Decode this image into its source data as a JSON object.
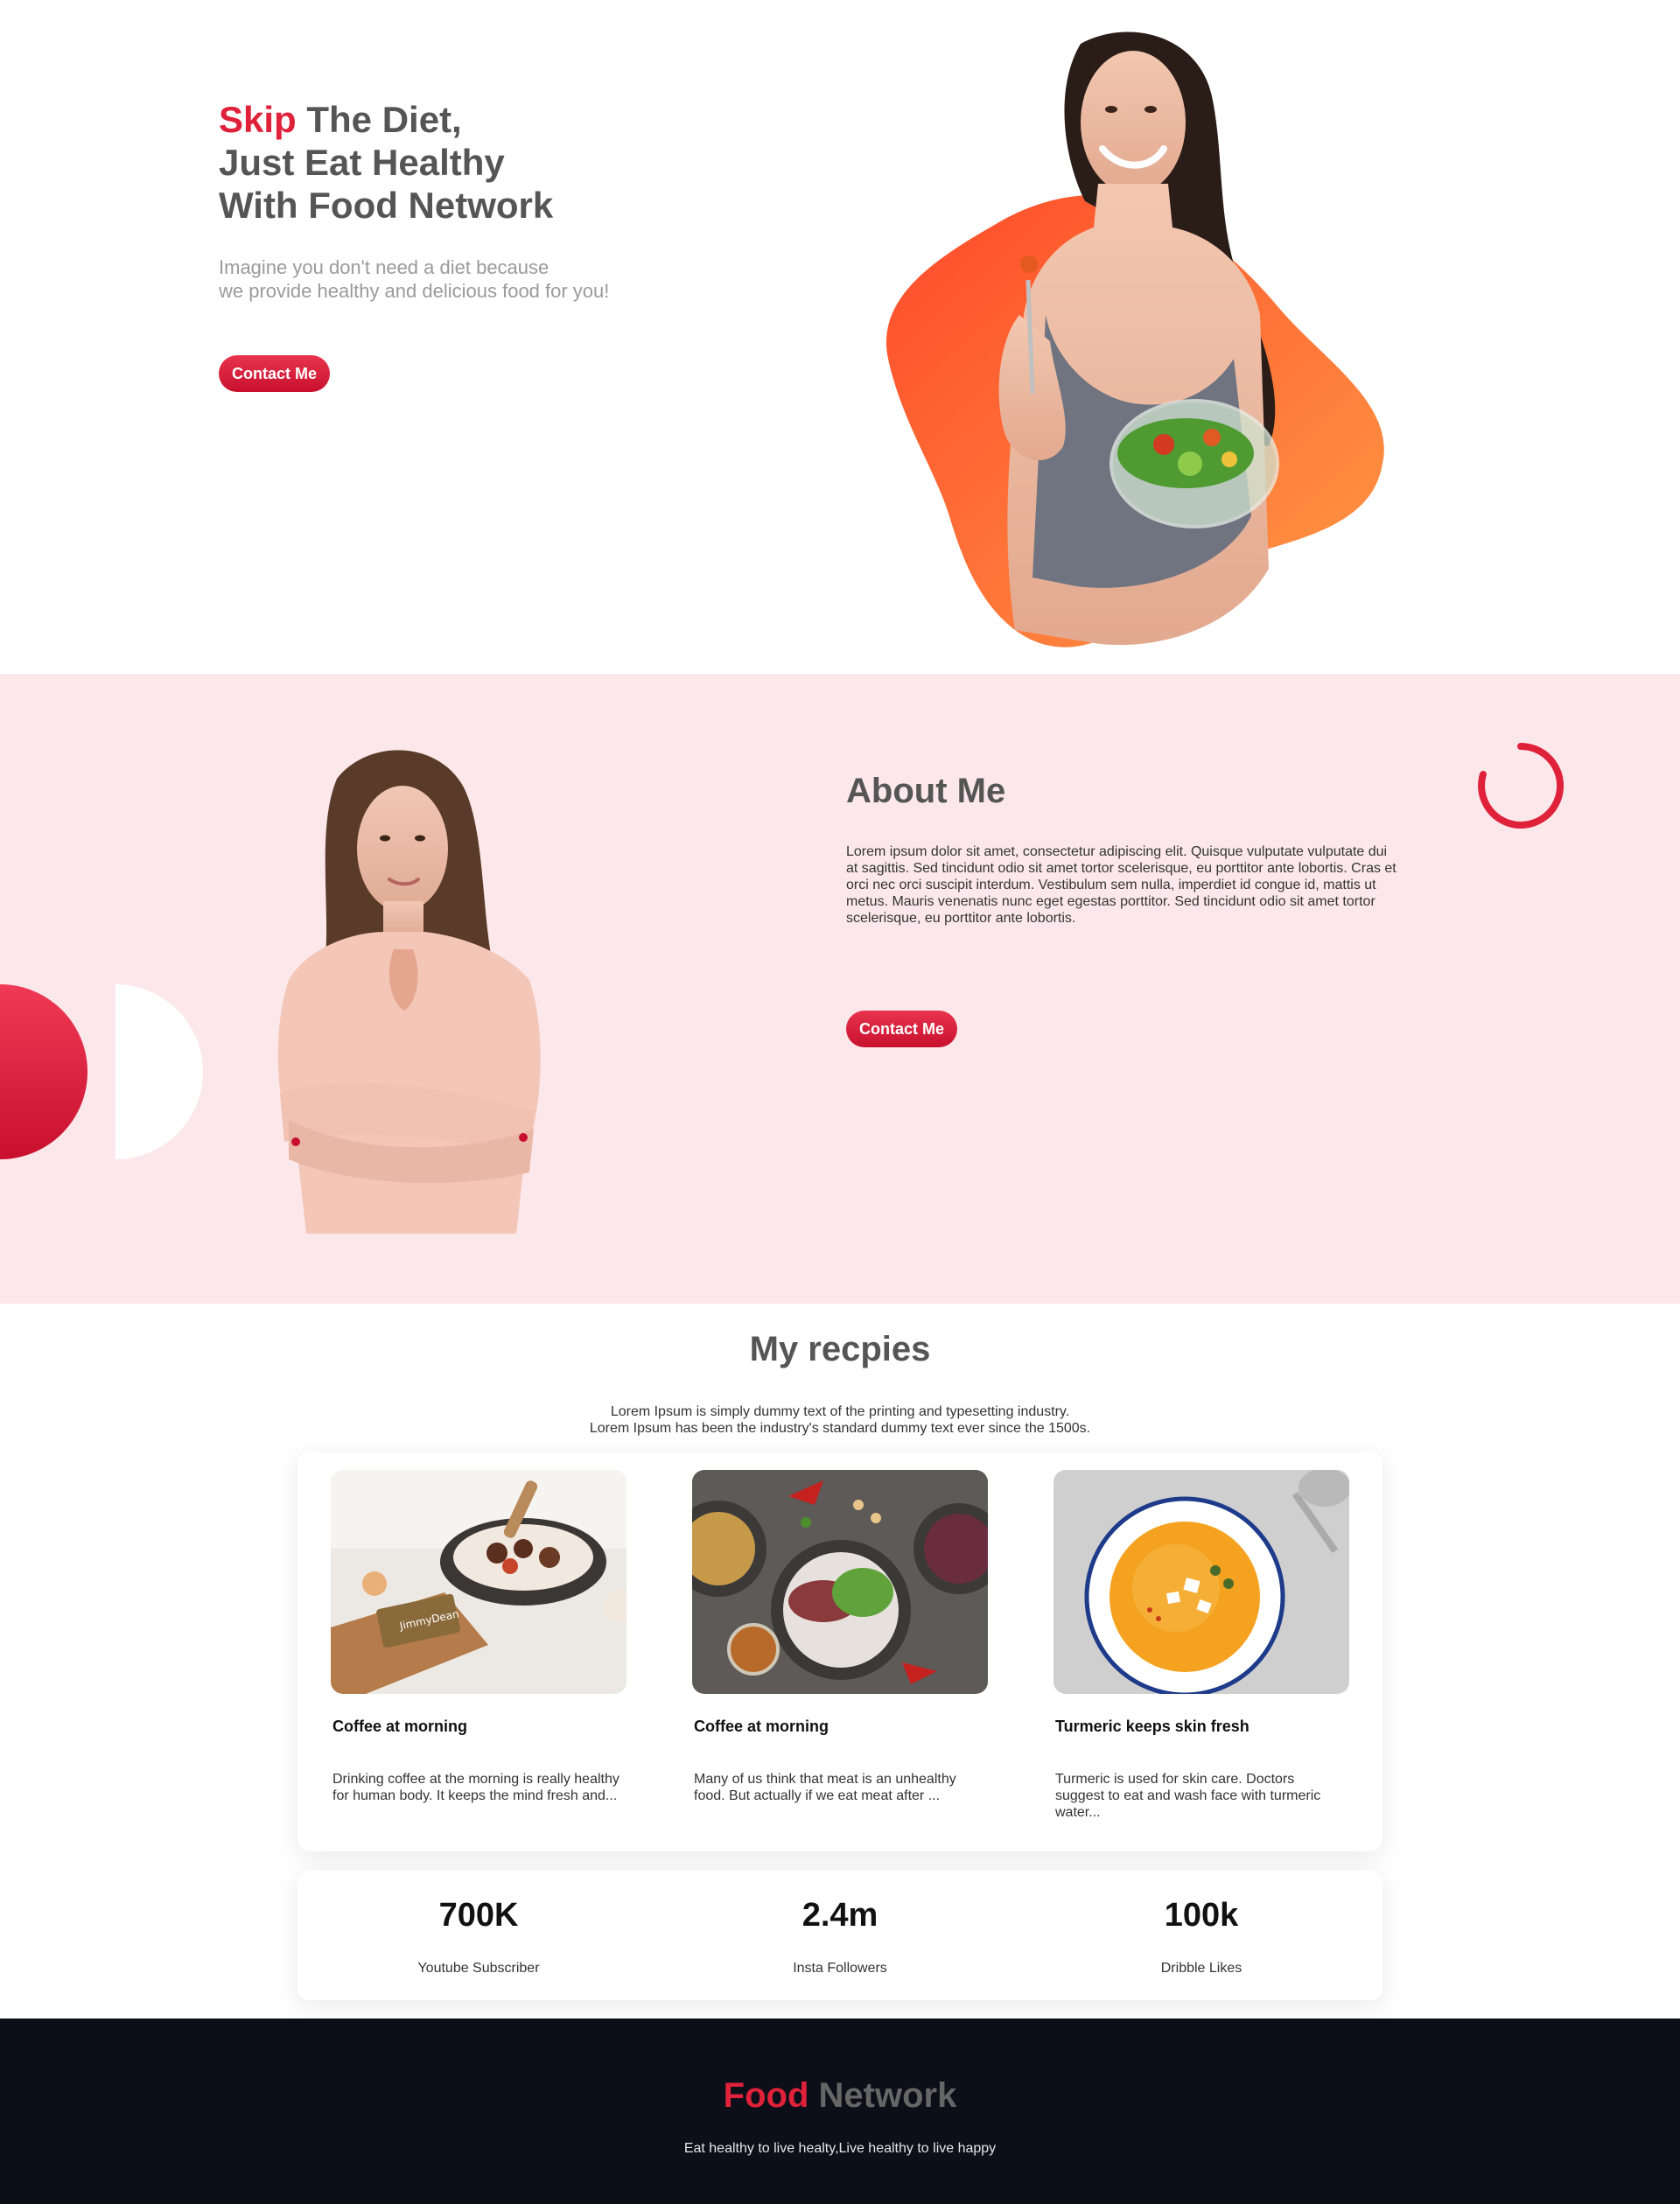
{
  "hero": {
    "title_accent": "Skip",
    "title_line1_rest": " The Diet,",
    "title_line2": "Just Eat Healthy",
    "title_line3": "With Food Network",
    "subtitle_line1": "Imagine you don't need a diet because",
    "subtitle_line2": "we provide healthy and delicious food for you!",
    "button_label": "Contact Me"
  },
  "about": {
    "title": "About Me",
    "text": "Lorem ipsum dolor sit amet, consectetur adipiscing elit. Quisque vulputate vulputate dui at sagittis. Sed tincidunt odio sit amet tortor scelerisque, eu porttitor ante lobortis. Cras et orci nec orci suscipit interdum. Vestibulum sem nulla, imperdiet id congue id, mattis ut metus. Mauris venenatis nunc eget egestas porttitor. Sed tincidunt odio sit amet tortor scelerisque, eu porttitor ante lobortis.",
    "button_label": "Contact Me"
  },
  "recipes": {
    "title": "My recpies",
    "subtitle_line1": "Lorem Ipsum is simply dummy text of the printing and typesetting industry.",
    "subtitle_line2": "Lorem Ipsum has been the industry's standard dummy text ever since the 1500s.",
    "cards": [
      {
        "title": "Coffee at morning",
        "text": "Drinking coffee at the morning is really healthy for human body. It keeps the mind fresh and...",
        "image": "breakfast-pan-photo"
      },
      {
        "title": "Coffee at morning",
        "text": "Many of us think that meat is an unhealthy food. But actually if we eat meat after ...",
        "image": "meat-salad-photo"
      },
      {
        "title": "Turmeric keeps skin fresh",
        "text": "Turmeric is used for skin care. Doctors suggest to eat and wash face with turmeric water...",
        "image": "turmeric-soup-photo"
      }
    ]
  },
  "stats": [
    {
      "value": "700K",
      "label": "Youtube Subscriber"
    },
    {
      "value": "2.4m",
      "label": "Insta Followers"
    },
    {
      "value": "100k",
      "label": "Dribble Likes"
    }
  ],
  "footer": {
    "brand_accent": "Food",
    "brand_rest": " Network",
    "tagline": "Eat healthy to live healty,Live healthy to live happy"
  },
  "colors": {
    "accent_red": "#e0213a",
    "about_bg": "#fce8eb",
    "footer_bg": "#0c0e18",
    "hero_blob_orange": "#ff7a2f"
  }
}
